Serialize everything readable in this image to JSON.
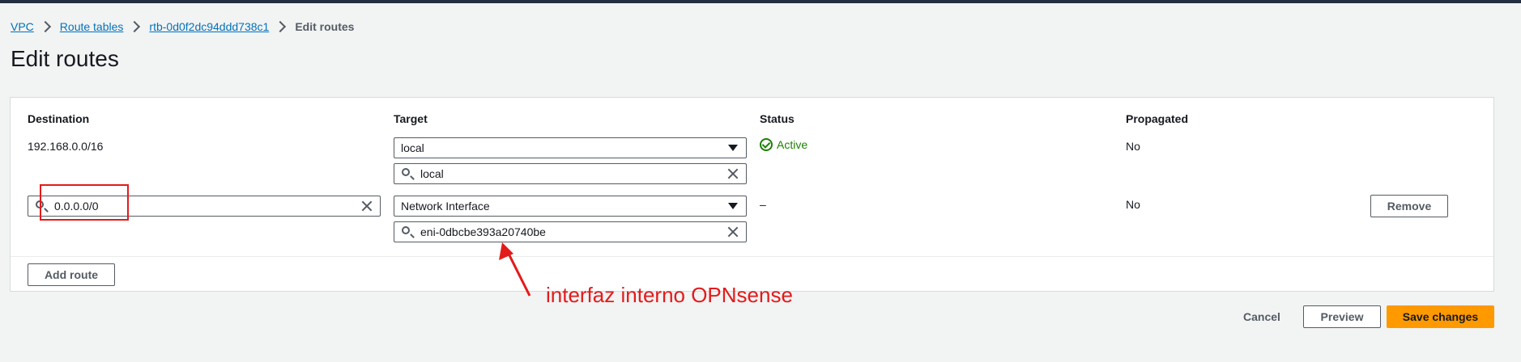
{
  "breadcrumb": {
    "items": [
      "VPC",
      "Route tables",
      "rtb-0d0f2dc94ddd738c1"
    ],
    "current": "Edit routes"
  },
  "page": {
    "title": "Edit routes"
  },
  "table": {
    "headers": {
      "destination": "Destination",
      "target": "Target",
      "status": "Status",
      "propagated": "Propagated"
    },
    "rows": [
      {
        "destination": "192.168.0.0/16",
        "target_type": "local",
        "target_value": "local",
        "status": "Active",
        "propagated": "No"
      },
      {
        "destination": "0.0.0.0/0",
        "target_type": "Network Interface",
        "target_value": "eni-0dbcbe393a20740be",
        "status": "–",
        "propagated": "No",
        "remove_label": "Remove"
      }
    ],
    "add_route_label": "Add route"
  },
  "footer": {
    "cancel": "Cancel",
    "preview": "Preview",
    "save": "Save changes"
  },
  "annotation": {
    "text": "interfaz interno OPNsense"
  },
  "colors": {
    "accent": "#0073bb",
    "primary": "#ff9900",
    "success": "#1d8102",
    "annotation": "#e31b1b"
  }
}
